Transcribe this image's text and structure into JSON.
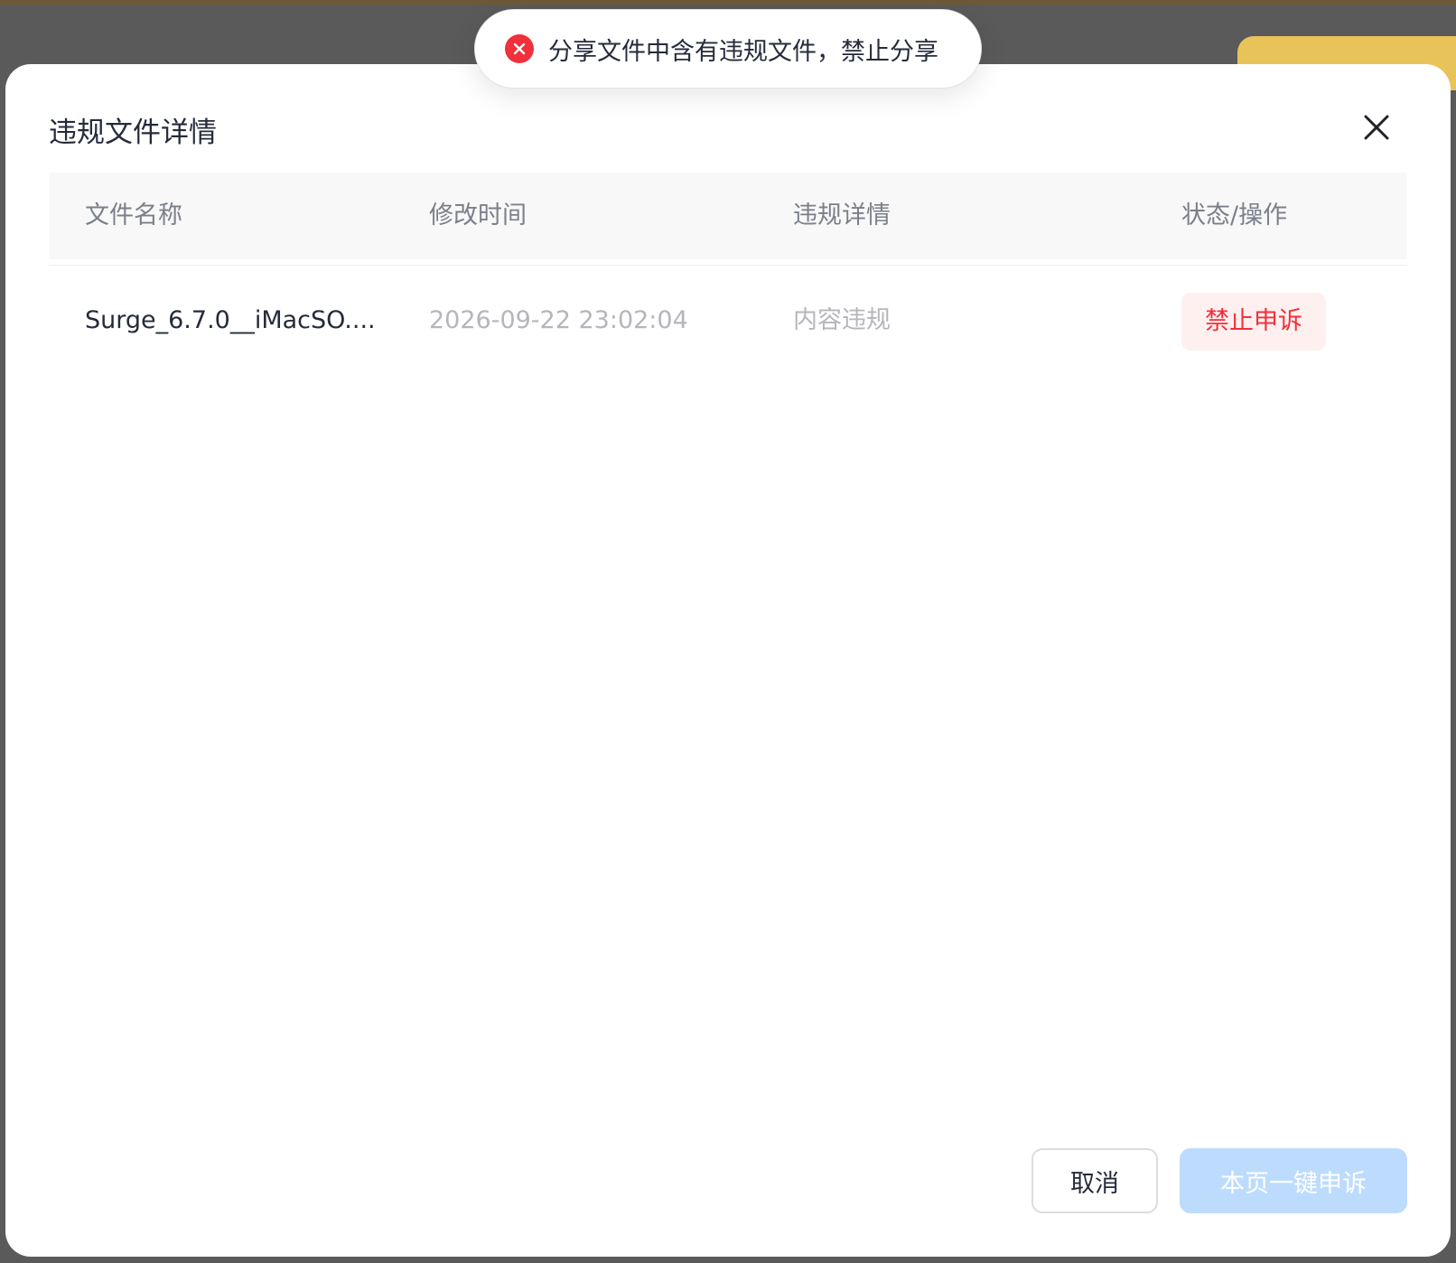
{
  "toast": {
    "icon": "error-circle-icon",
    "message": "分享文件中含有违规文件，禁止分享",
    "color": "#f0303a"
  },
  "modal": {
    "title": "违规文件详情",
    "close_icon": "close-icon"
  },
  "table": {
    "columns": [
      "文件名称",
      "修改时间",
      "违规详情",
      "状态/操作"
    ],
    "rows": [
      {
        "file_name": "Surge_6.7.0__iMacSO....",
        "modified_time": "2026-09-22 23:02:04",
        "violation_detail": "内容违规",
        "status": "禁止申诉"
      }
    ]
  },
  "footer": {
    "cancel_label": "取消",
    "appeal_all_label": "本页一键申诉"
  },
  "colors": {
    "error_red": "#f0303a",
    "primary_disabled": "#bddcfd",
    "text_primary": "#252b3a",
    "text_muted": "#b4b6bc"
  }
}
